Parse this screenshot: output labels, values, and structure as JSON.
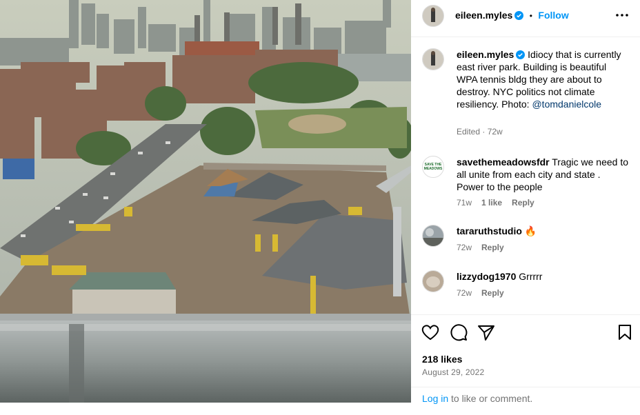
{
  "post": {
    "author": "eileen.myles",
    "follow_label": "Follow",
    "separator": "•",
    "caption_author": "eileen.myles",
    "caption_text": "Idiocy that is currently east river park. Building is beautiful WPA tennis bldg they are about to destroy. NYC politics not climate resiliency. Photo:",
    "caption_mention": "@tomdanielcole",
    "caption_meta": "Edited · 72w",
    "likes": "218 likes",
    "date": "August 29, 2022"
  },
  "comments": [
    {
      "user": "savethemeadowsfdr",
      "text": "Tragic we need to all unite from each city and state . Power to the people",
      "time": "71w",
      "likes": "1 like",
      "reply": "Reply",
      "avatar_text": "SAVE THE MEADOWS"
    },
    {
      "user": "tararuthstudio",
      "text": "🔥",
      "time": "72w",
      "reply": "Reply"
    },
    {
      "user": "lizzydog1970",
      "text": "Grrrrr",
      "time": "72w",
      "reply": "Reply"
    }
  ],
  "login": {
    "link": "Log in",
    "rest": "to like or comment."
  },
  "icons": {
    "verified": "verified-badge-icon",
    "more": "more-options-icon",
    "like": "heart-icon",
    "comment": "comment-icon",
    "share": "share-icon",
    "save": "bookmark-icon"
  },
  "colors": {
    "accent": "#0095f6",
    "muted": "#737373",
    "link": "#00376b"
  }
}
